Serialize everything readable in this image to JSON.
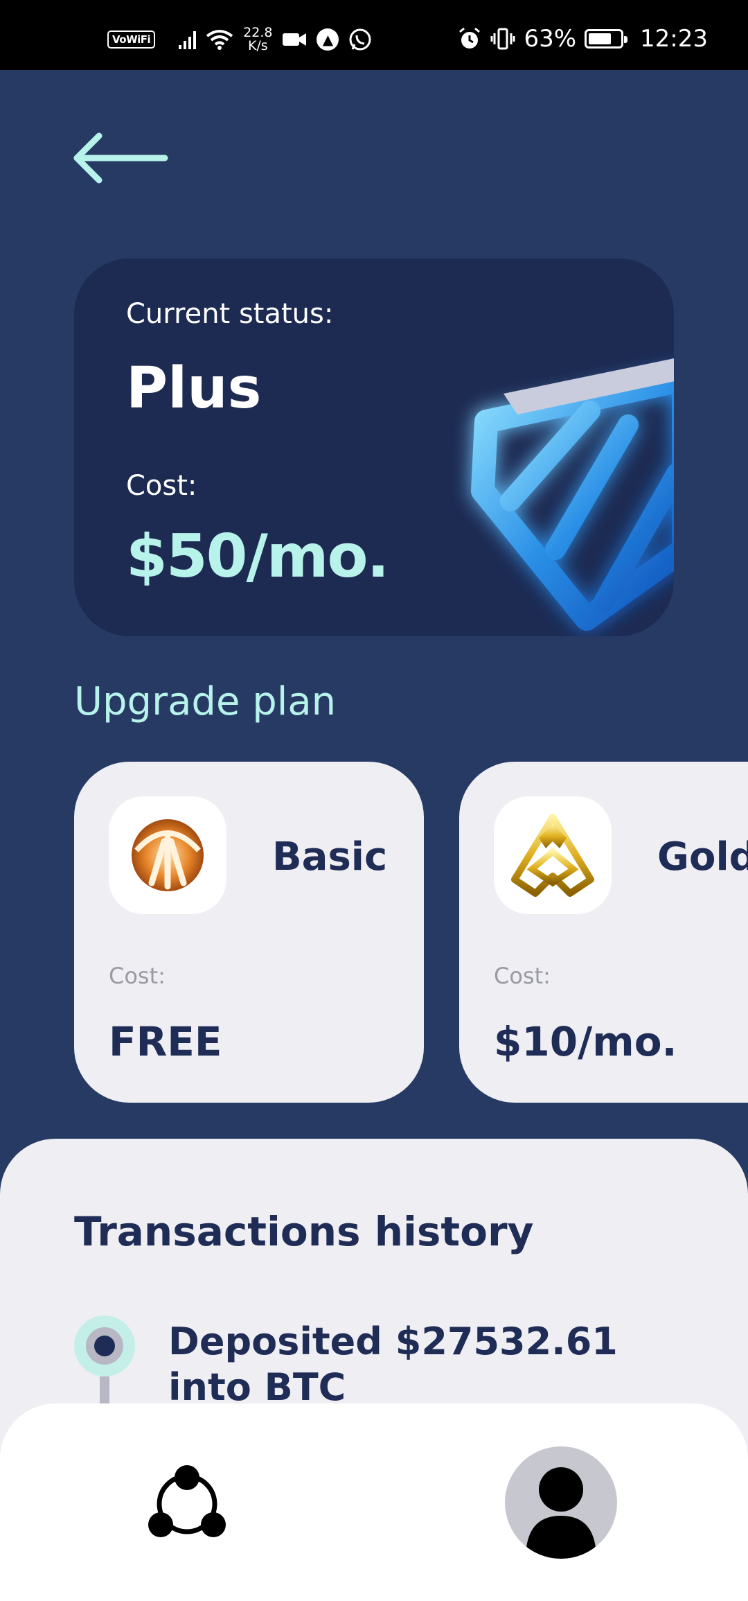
{
  "status_bar": {
    "vowifi": "VoWiFi",
    "net_speed_value": "22.8",
    "net_speed_unit": "K/s",
    "battery": "63%",
    "time": "12:23",
    "icons": [
      "signal-icon",
      "wifi-icon",
      "video-icon",
      "app-icon",
      "whatsapp-icon",
      "alarm-icon",
      "vibrate-icon",
      "battery-icon"
    ]
  },
  "back": {
    "icon": "arrow-left-icon"
  },
  "current": {
    "status_label": "Current status:",
    "plan_name": "Plus",
    "cost_label": "Cost:",
    "cost_value": "$50/mo."
  },
  "upgrade": {
    "title": "Upgrade plan",
    "plans": [
      {
        "name": "Basic",
        "cost_label": "Cost:",
        "cost_value": "FREE",
        "icon": "bronze-badge-icon"
      },
      {
        "name": "Gold",
        "cost_label": "Cost:",
        "cost_value": "$10/mo.",
        "icon": "gold-badge-icon"
      }
    ]
  },
  "transactions": {
    "title": "Transactions history",
    "items": [
      {
        "text": "Deposited $27532.61 into BTC"
      }
    ]
  },
  "bottom_nav": {
    "items": [
      {
        "icon": "network-icon"
      },
      {
        "icon": "profile-icon"
      }
    ]
  },
  "colors": {
    "background": "#263a63",
    "card_dark": "#1d2a52",
    "accent": "#b7f3ea",
    "card_light": "#eeeef3",
    "text_dark": "#1f2c55"
  }
}
